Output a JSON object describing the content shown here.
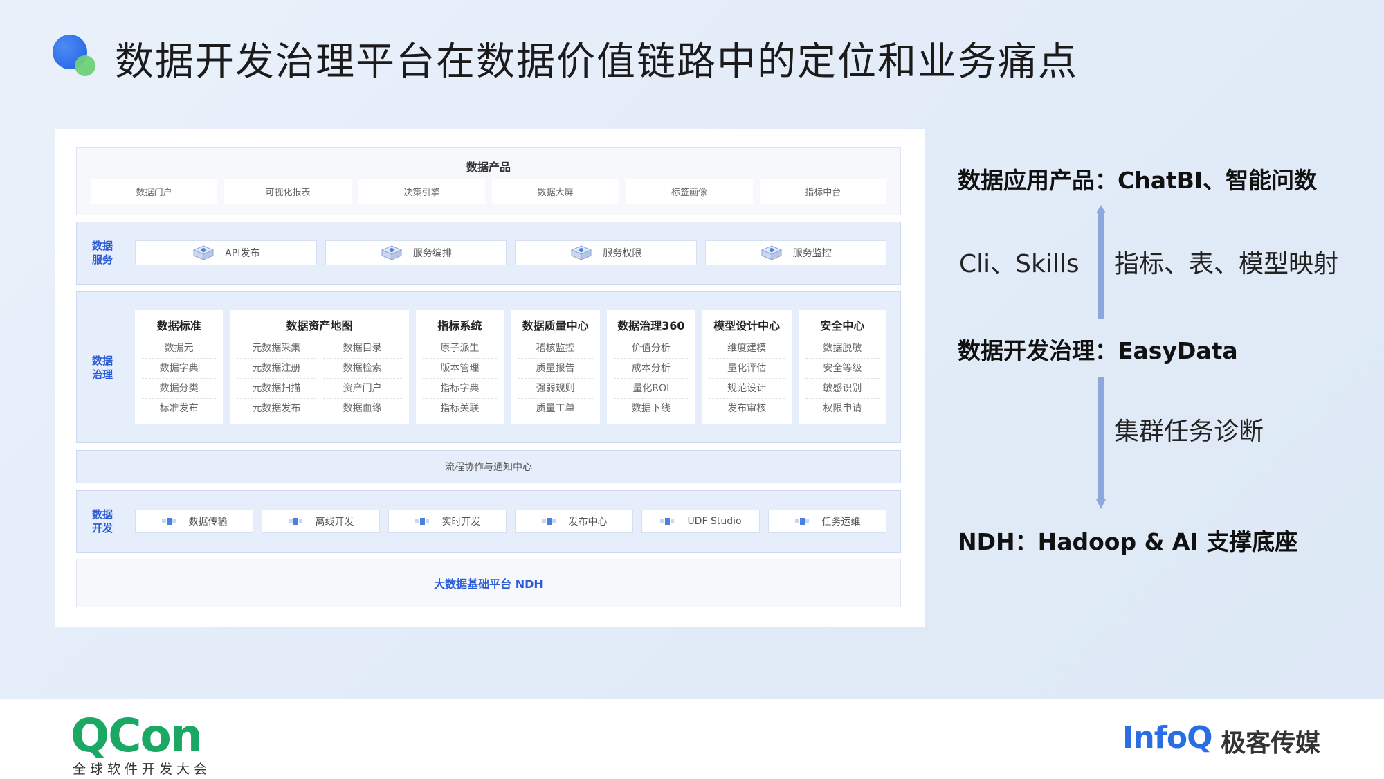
{
  "title": "数据开发治理平台在数据价值链路中的定位和业务痛点",
  "product": {
    "title": "数据产品",
    "items": [
      "数据门户",
      "可视化报表",
      "决策引擎",
      "数据大屏",
      "标签画像",
      "指标中台"
    ]
  },
  "service": {
    "label_line1": "数据",
    "label_line2": "服务",
    "items": [
      "API发布",
      "服务编排",
      "服务权限",
      "服务监控"
    ]
  },
  "governance": {
    "label_line1": "数据",
    "label_line2": "治理",
    "standard": {
      "title": "数据标准",
      "items": [
        "数据元",
        "数据字典",
        "数据分类",
        "标准发布"
      ]
    },
    "asset_map": {
      "title": "数据资产地图",
      "left": [
        "元数据采集",
        "元数据注册",
        "元数据扫描",
        "元数据发布"
      ],
      "right": [
        "数据目录",
        "数据检索",
        "资产门户",
        "数据血缘"
      ]
    },
    "metrics": {
      "title": "指标系统",
      "items": [
        "原子派生",
        "版本管理",
        "指标字典",
        "指标关联"
      ]
    },
    "quality": {
      "title": "数据质量中心",
      "items": [
        "稽核监控",
        "质量报告",
        "强弱规则",
        "质量工单"
      ]
    },
    "gov360": {
      "title": "数据治理360",
      "items": [
        "价值分析",
        "成本分析",
        "量化ROI",
        "数据下线"
      ]
    },
    "model": {
      "title": "模型设计中心",
      "items": [
        "维度建模",
        "量化评估",
        "规范设计",
        "发布审核"
      ]
    },
    "security": {
      "title": "安全中心",
      "items": [
        "数据脱敏",
        "安全等级",
        "敏感识别",
        "权限申请"
      ]
    }
  },
  "flow": {
    "label": "流程协作与通知中心"
  },
  "dev": {
    "label_line1": "数据",
    "label_line2": "开发",
    "items": [
      "数据传输",
      "离线开发",
      "实时开发",
      "发布中心",
      "UDF Studio",
      "任务运维"
    ]
  },
  "ndh": {
    "label": "大数据基础平台 NDH"
  },
  "right": {
    "app_product": "数据应用产品：ChatBI、智能问数",
    "cli_skills": "Cli、Skills",
    "mapping": "指标、表、模型映射",
    "easydata": "数据开发治理：EasyData",
    "diagnosis": "集群任务诊断",
    "ndh_support": "NDH：Hadoop & AI 支撑底座"
  },
  "footer": {
    "qcon": "QCon",
    "qcon_sub": "全球软件开发大会",
    "infoq": "InfoQ",
    "infoq_cn": "极客传媒"
  },
  "colors": {
    "accent_blue": "#2a5bd7",
    "layer_bg": "#e6edfb",
    "arrow": "#8aa8dc",
    "qcon_green": "#1aa864",
    "infoq_blue": "#2a6ee6"
  }
}
